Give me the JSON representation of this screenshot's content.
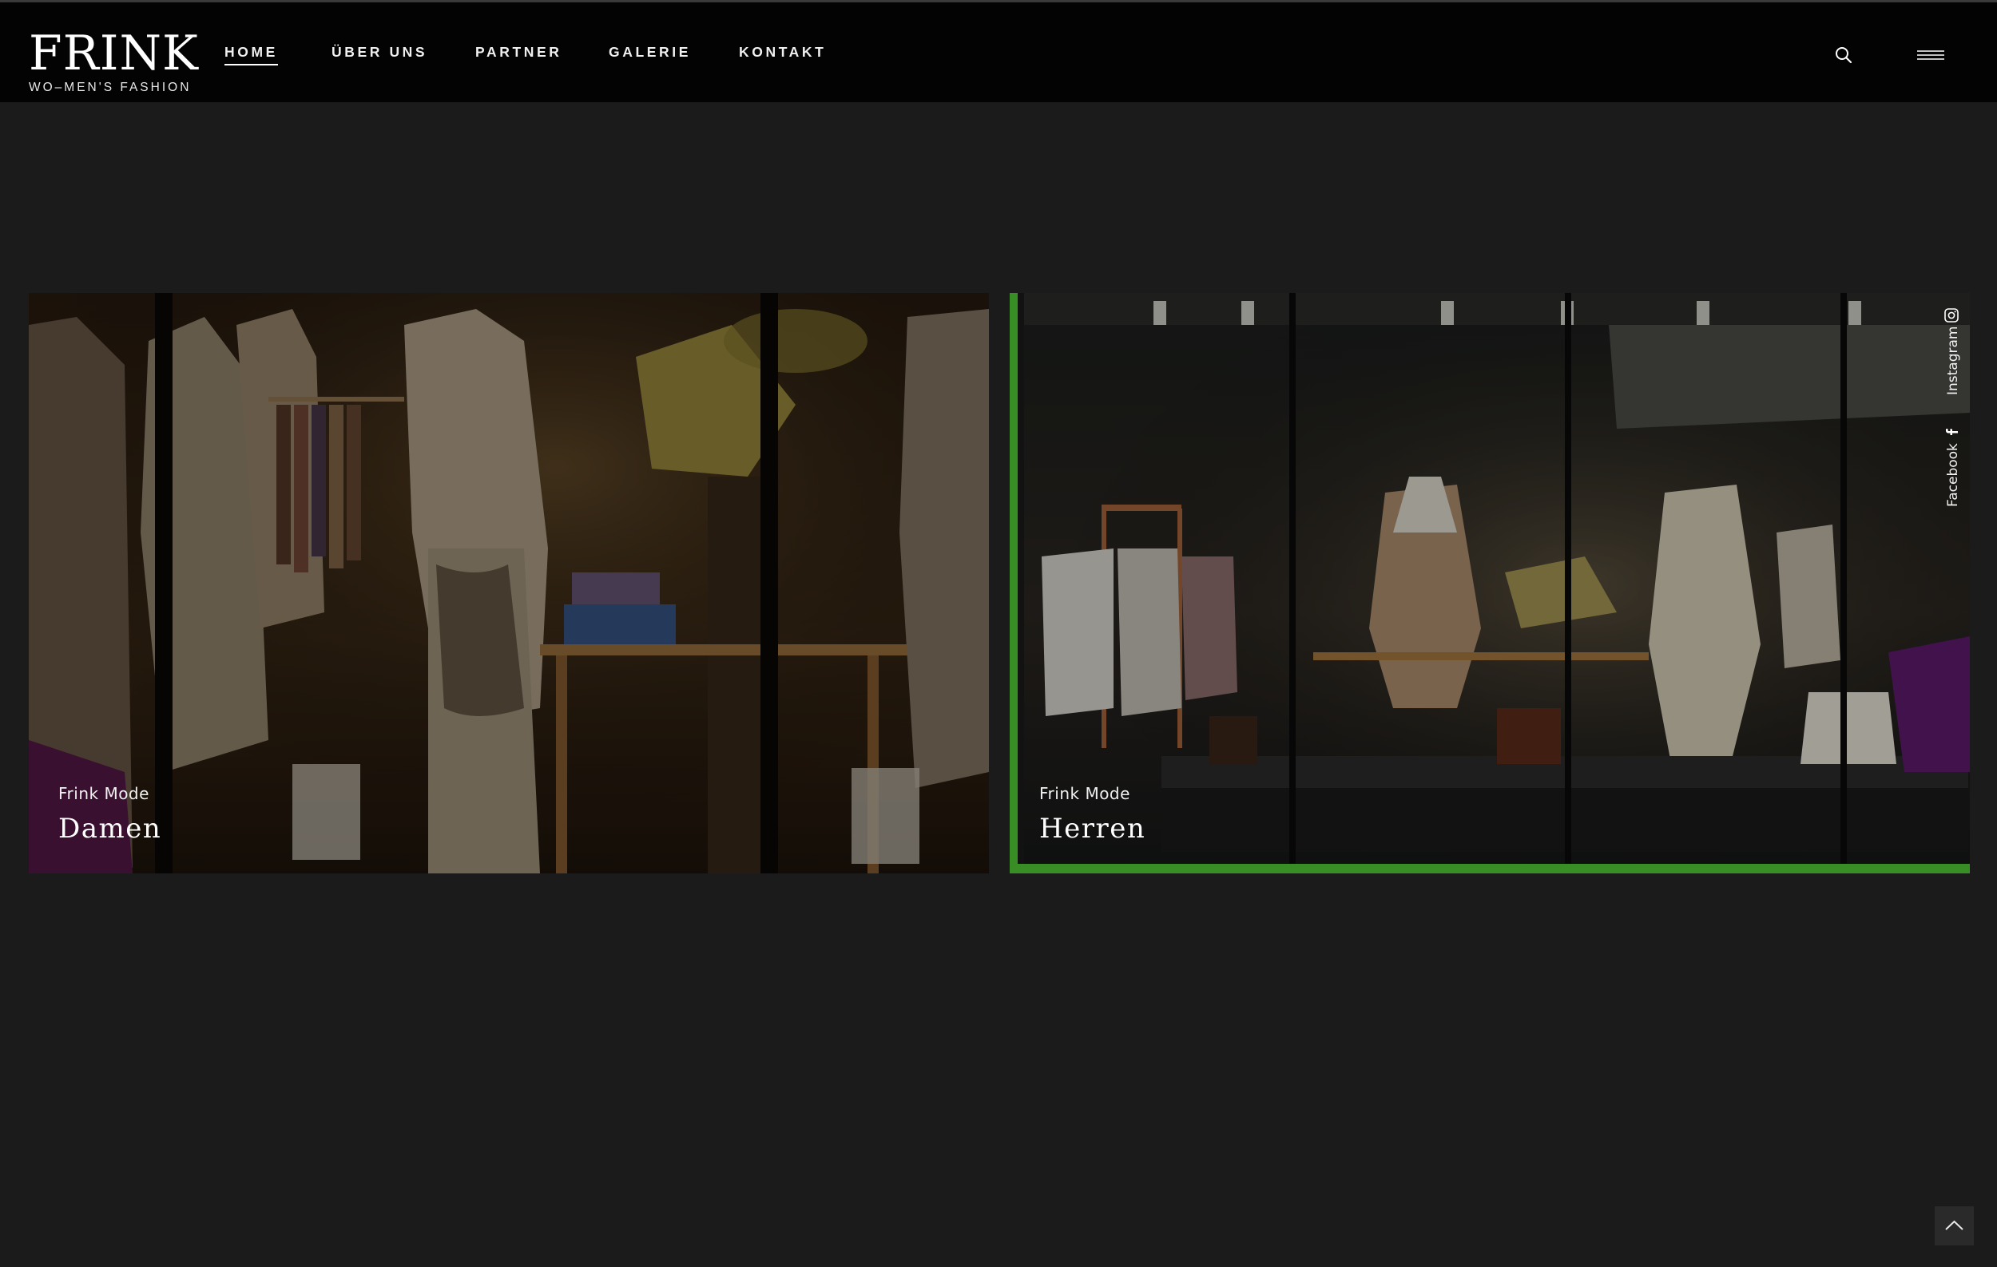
{
  "brand": {
    "name": "FRINK",
    "tagline": "WO–MEN'S FASHION"
  },
  "nav": {
    "items": [
      {
        "label": "HOME",
        "active": true
      },
      {
        "label": "ÜBER UNS",
        "active": false
      },
      {
        "label": "PARTNER",
        "active": false
      },
      {
        "label": "GALERIE",
        "active": false
      },
      {
        "label": "KONTAKT",
        "active": false
      }
    ],
    "search_icon": "search-icon",
    "menu_icon": "hamburger-menu-icon"
  },
  "cards": [
    {
      "kicker": "Frink Mode",
      "title": "Damen",
      "image": "boutique-window-womens-display"
    },
    {
      "kicker": "Frink Mode",
      "title": "Herren",
      "image": "boutique-window-mens-display"
    }
  ],
  "social": {
    "instagram": "Instagram",
    "facebook": "Facebook"
  },
  "back_to_top_icon": "chevron-up-icon",
  "colors": {
    "header_bg": "#030303",
    "page_bg": "#1b1b1b",
    "accent_green": "#5ad43a"
  }
}
